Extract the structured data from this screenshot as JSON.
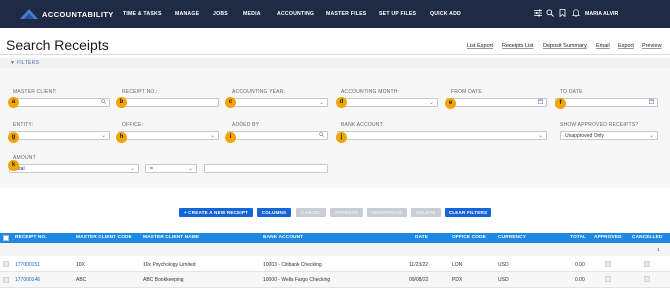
{
  "app": {
    "logo_text": "ACCOUNTABILITY",
    "logo_tm": "™"
  },
  "nav": {
    "items": [
      "TIME & TASKS",
      "MANAGE",
      "JOBS",
      "MEDIA",
      "ACCOUNTING",
      "MASTER FILES",
      "SET UP FILES",
      "QUICK ADD"
    ],
    "user_name": "MARIA ALVIR",
    "icons": [
      "sliders-icon",
      "search-icon",
      "bookmark-icon",
      "bell-icon",
      "user-icon"
    ]
  },
  "page": {
    "title": "Search Receipts",
    "links": [
      "List Export",
      "Receipts List",
      "Deposit Summary",
      "Email",
      "Export",
      "Preview"
    ]
  },
  "filters": {
    "section_label": "▼ FILTERS",
    "master_client": {
      "label": "MASTER CLIENT:",
      "value": "",
      "badge": "a"
    },
    "receipt_no": {
      "label": "RECEIPT NO.:",
      "value": "",
      "badge": "b"
    },
    "accounting_year": {
      "label": "ACCOUNTING YEAR:",
      "value": "",
      "badge": "c"
    },
    "accounting_month": {
      "label": "ACCOUNTING MONTH:",
      "value": "",
      "badge": "d"
    },
    "from_date": {
      "label": "FROM DATE",
      "value": "",
      "badge": "e"
    },
    "to_date": {
      "label": "TO DATE",
      "value": "",
      "badge": "f"
    },
    "entity": {
      "label": "ENTITY:",
      "value": "",
      "badge": "g"
    },
    "office": {
      "label": "OFFICE:",
      "value": "",
      "badge": "h"
    },
    "added_by": {
      "label": "ADDED BY",
      "value": "",
      "badge": "i"
    },
    "bank_account": {
      "label": "BANK ACCOUNT:",
      "value": "",
      "badge": "j"
    },
    "show_approved": {
      "label": "SHOW APPROVED RECEIPTS?",
      "value": "Unapproved Only"
    },
    "amount": {
      "label": "AMOUNT",
      "field": "Total",
      "operator": "=",
      "value": "",
      "badge": "k"
    }
  },
  "buttons": {
    "create": "+ CREATE A NEW RECEIPT",
    "columns": "COLUMNS",
    "cancel": "CANCEL",
    "approve": "APPROVE",
    "unapprove": "UNAPPROVE",
    "delete": "DELETE",
    "clear": "CLEAR FILTERS"
  },
  "table": {
    "columns": [
      "RECEIPT NO.",
      "MASTER CLIENT CODE",
      "MASTER CLIENT NAME",
      "BANK ACCOUNT",
      "DATE",
      "OFFICE CODE",
      "CURRENCY",
      "TOTAL",
      "APPROVED",
      "CANCELLED"
    ],
    "page": "1",
    "rows": [
      {
        "receipt_no": "177000151",
        "client_code": "10X",
        "client_name": "10x Psychology Limited",
        "bank_account": "10003 - Citibank Checking",
        "date": "11/23/22",
        "office": "LON",
        "currency": "USD",
        "total": "0.00"
      },
      {
        "receipt_no": "177000146",
        "client_code": "ABC",
        "client_name": "ABC Bookkeeping",
        "bank_account": "10000 - Wells Fargo Checking",
        "date": "09/08/22",
        "office": "PDX",
        "currency": "USD",
        "total": "0.00"
      }
    ]
  },
  "colors": {
    "nav_bg": "#1f2a44",
    "table_header": "#1e88e5",
    "primary_button": "#1565d8",
    "badge": "#f0a500"
  }
}
